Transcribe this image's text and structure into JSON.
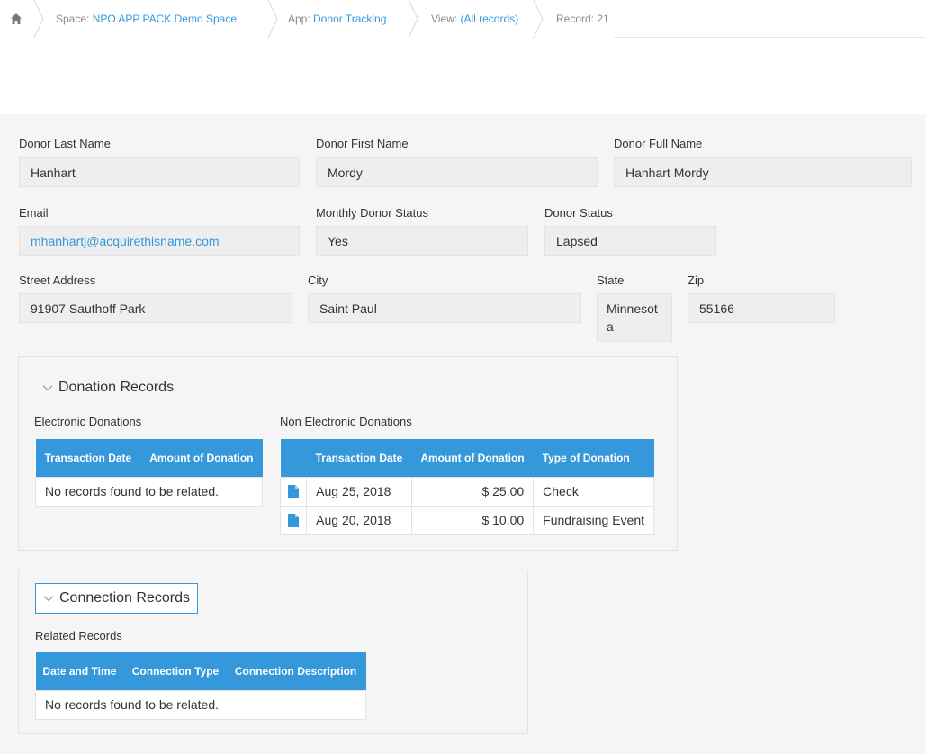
{
  "breadcrumb": {
    "space_prefix": "Space: ",
    "space_name": "NPO APP PACK Demo Space",
    "app_prefix": "App: ",
    "app_name": "Donor Tracking",
    "view_prefix": "View: ",
    "view_name": "(All records)",
    "record": "Record: 21"
  },
  "fields": {
    "donor_last_name": {
      "label": "Donor Last Name",
      "value": "Hanhart"
    },
    "donor_first_name": {
      "label": "Donor First Name",
      "value": "Mordy"
    },
    "donor_full_name": {
      "label": "Donor Full Name",
      "value": "Hanhart Mordy"
    },
    "email": {
      "label": "Email",
      "value": "mhanhartj@acquirethisname.com"
    },
    "monthly_donor_status": {
      "label": "Monthly Donor Status",
      "value": "Yes"
    },
    "donor_status": {
      "label": "Donor Status",
      "value": "Lapsed"
    },
    "street_address": {
      "label": "Street Address",
      "value": "91907 Sauthoff Park"
    },
    "city": {
      "label": "City",
      "value": "Saint Paul"
    },
    "state": {
      "label": "State",
      "value": "Minnesota"
    },
    "zip": {
      "label": "Zip",
      "value": "55166"
    }
  },
  "donation_records": {
    "title": "Donation Records",
    "electronic": {
      "label": "Electronic Donations",
      "columns": [
        "Transaction Date",
        "Amount of Donation"
      ],
      "empty": "No records found to be related."
    },
    "non_electronic": {
      "label": "Non Electronic Donations",
      "columns": [
        "Transaction Date",
        "Amount of Donation",
        "Type of Donation"
      ],
      "rows": [
        {
          "date": "Aug 25, 2018",
          "amount": "$ 25.00",
          "type": "Check"
        },
        {
          "date": "Aug 20, 2018",
          "amount": "$ 10.00",
          "type": "Fundraising Event"
        }
      ]
    }
  },
  "connection_records": {
    "title": "Connection Records",
    "related": {
      "label": "Related Records",
      "columns": [
        "Date and Time",
        "Connection Type",
        "Connection Description"
      ],
      "empty": "No records found to be related."
    }
  },
  "colors": {
    "accent": "#3498db",
    "panel_bg": "#f5f5f5",
    "field_bg": "#eeeeee",
    "border": "#e3e3e3"
  }
}
